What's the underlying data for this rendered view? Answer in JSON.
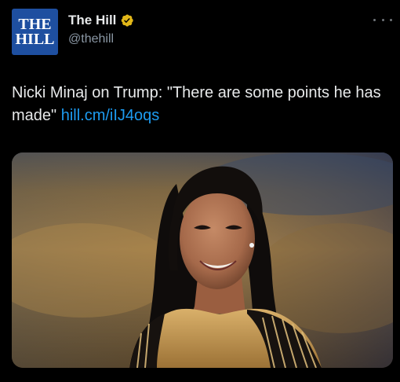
{
  "account": {
    "avatar_logo_line1": "THE",
    "avatar_logo_line2": "HILL",
    "display_name": "The Hill",
    "handle": "@thehill"
  },
  "tweet": {
    "text": "Nicki Minaj on Trump: \"There are some points he has made\"",
    "link": "hill.cm/iIJ4oqs"
  },
  "media": {
    "description_icon": "photo"
  },
  "colors": {
    "background": "#000000",
    "text": "#e7e9ea",
    "secondary": "#8b98a5",
    "link": "#1d9bf0",
    "verified": "#e2b719",
    "avatar_bg": "#1e4fa0"
  }
}
